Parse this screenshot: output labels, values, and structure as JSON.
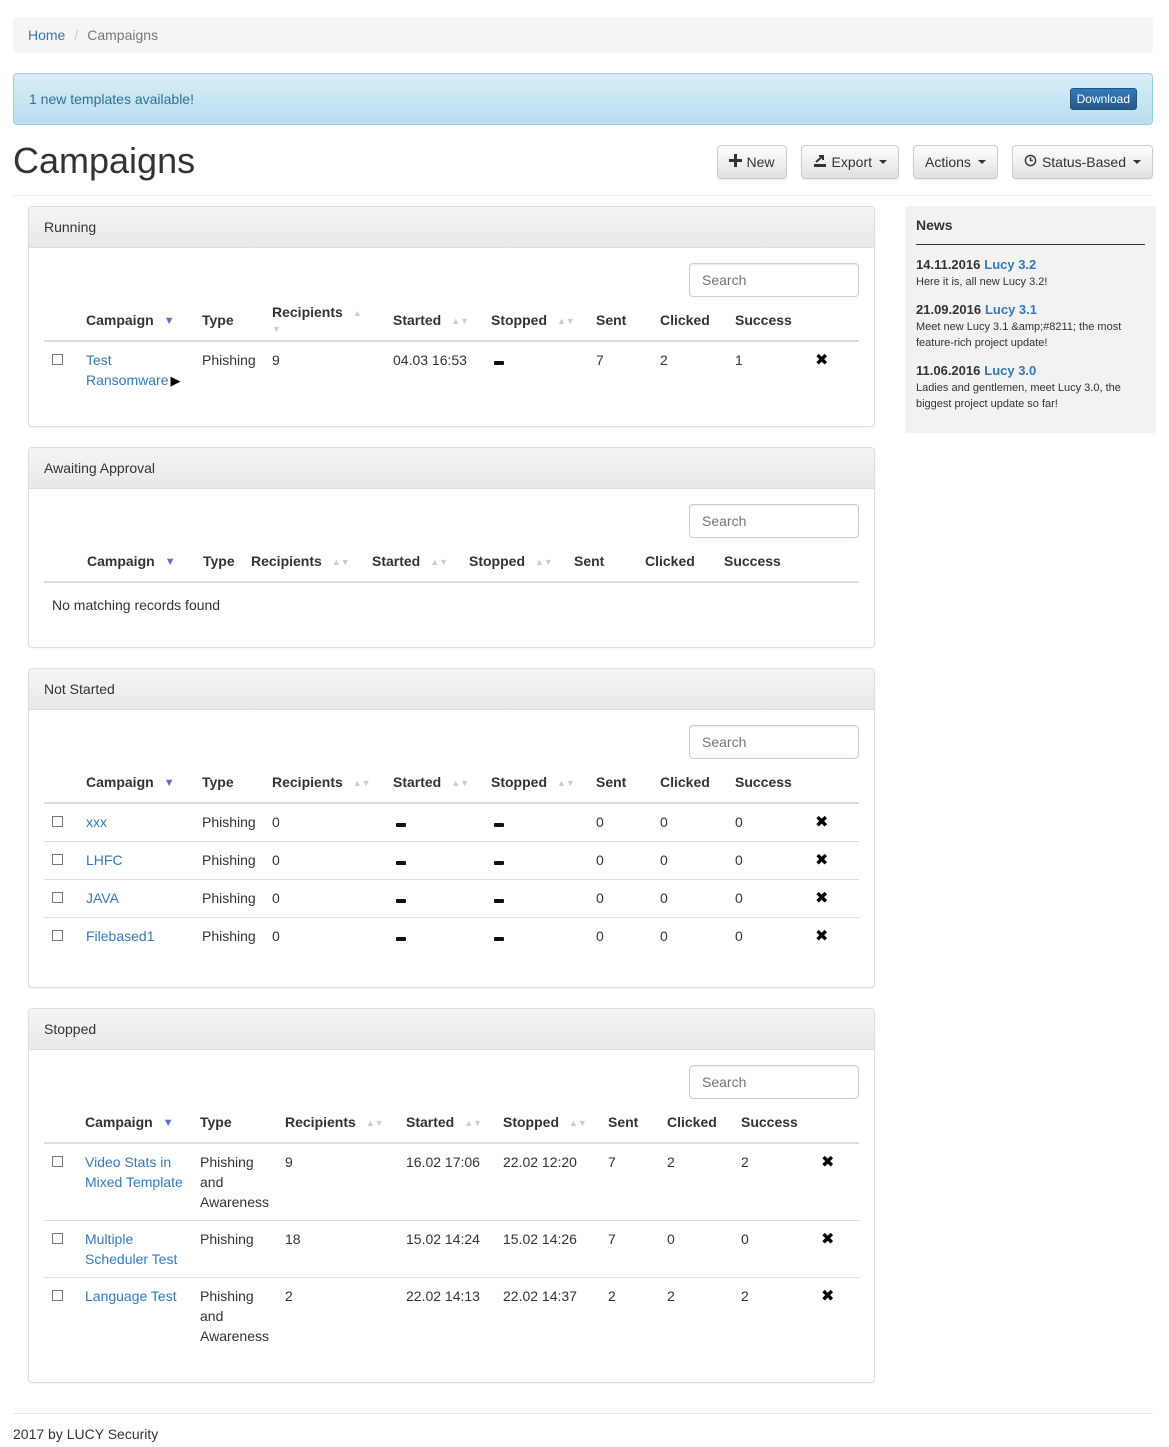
{
  "breadcrumb": {
    "home": "Home",
    "current": "Campaigns"
  },
  "alert": {
    "message": "1 new templates available!",
    "button": "Download"
  },
  "header": {
    "title": "Campaigns",
    "buttons": {
      "new": "New",
      "export": "Export",
      "actions": "Actions",
      "status": "Status-Based"
    }
  },
  "search_placeholder": "Search",
  "columns": [
    "Campaign",
    "Type",
    "Recipients",
    "Started",
    "Stopped",
    "Sent",
    "Clicked",
    "Success"
  ],
  "panels": {
    "running": {
      "title": "Running",
      "rows": [
        {
          "campaign": "Test Ransomware",
          "type": "Phishing",
          "recipients": "9",
          "started": "04.03 16:53",
          "stopped": "",
          "sent": "7",
          "clicked": "2",
          "success": "1"
        }
      ]
    },
    "awaiting": {
      "title": "Awaiting Approval",
      "empty": "No matching records found",
      "rows": []
    },
    "not_started": {
      "title": "Not Started",
      "rows": [
        {
          "campaign": "xxx",
          "type": "Phishing",
          "recipients": "0",
          "started": "",
          "stopped": "",
          "sent": "0",
          "clicked": "0",
          "success": "0"
        },
        {
          "campaign": "LHFC",
          "type": "Phishing",
          "recipients": "0",
          "started": "",
          "stopped": "",
          "sent": "0",
          "clicked": "0",
          "success": "0"
        },
        {
          "campaign": "JAVA",
          "type": "Phishing",
          "recipients": "0",
          "started": "",
          "stopped": "",
          "sent": "0",
          "clicked": "0",
          "success": "0"
        },
        {
          "campaign": "Filebased1",
          "type": "Phishing",
          "recipients": "0",
          "started": "",
          "stopped": "",
          "sent": "0",
          "clicked": "0",
          "success": "0"
        }
      ]
    },
    "stopped": {
      "title": "Stopped",
      "rows": [
        {
          "campaign": "Video Stats in Mixed Template",
          "type": "Phishing and Awareness",
          "recipients": "9",
          "started": "16.02 17:06",
          "stopped": "22.02 12:20",
          "sent": "7",
          "clicked": "2",
          "success": "2"
        },
        {
          "campaign": "Multiple Scheduler Test",
          "type": "Phishing",
          "recipients": "18",
          "started": "15.02 14:24",
          "stopped": "15.02 14:26",
          "sent": "7",
          "clicked": "0",
          "success": "0"
        },
        {
          "campaign": "Language Test",
          "type": "Phishing and Awareness",
          "recipients": "2",
          "started": "22.02 14:13",
          "stopped": "22.02 14:37",
          "sent": "2",
          "clicked": "2",
          "success": "2"
        }
      ]
    }
  },
  "news": {
    "title": "News",
    "items": [
      {
        "date": "14.11.2016",
        "version": "Lucy 3.2",
        "text": "Here it is, all new Lucy 3.2!"
      },
      {
        "date": "21.09.2016",
        "version": "Lucy 3.1",
        "text": "Meet new Lucy 3.1 &amp;#8211; the most feature-rich project update!"
      },
      {
        "date": "11.06.2016",
        "version": "Lucy 3.0",
        "text": "Ladies and gentlemen, meet Lucy 3.0, the biggest project update so far!"
      }
    ]
  },
  "footer": "2017 by LUCY Security"
}
